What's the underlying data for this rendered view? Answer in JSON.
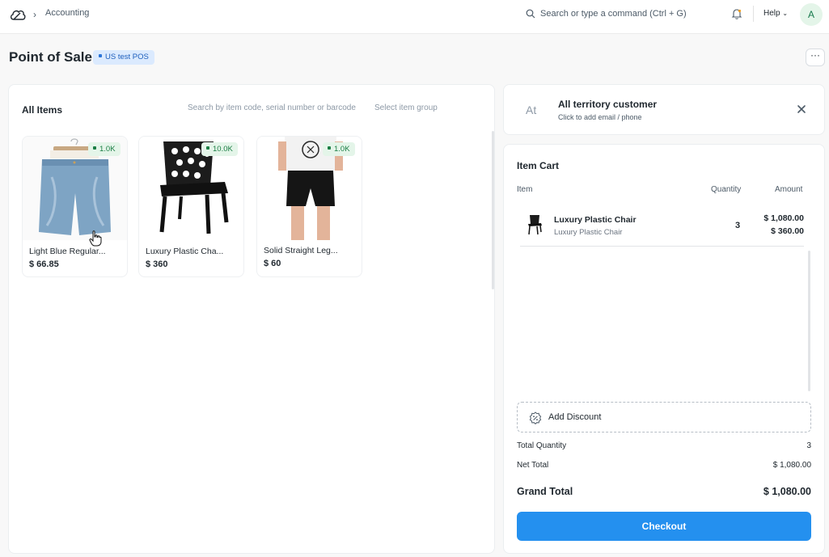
{
  "navbar": {
    "breadcrumb": "Accounting",
    "search_placeholder": "Search or type a command (Ctrl + G)",
    "help_label": "Help",
    "avatar_initial": "A"
  },
  "page": {
    "title": "Point of Sale",
    "pos_profile": "US test POS",
    "more_label": "···"
  },
  "items": {
    "title": "All Items",
    "search_placeholder": "Search by item code, serial number or barcode",
    "group_placeholder": "Select item group",
    "cards": [
      {
        "name": "Light Blue Regular...",
        "price": "$ 66.85",
        "stock": "1.0K",
        "image": "denim-shorts"
      },
      {
        "name": "Luxury Plastic Cha...",
        "price": "$ 360",
        "stock": "10.0K",
        "image": "black-chair"
      },
      {
        "name": "Solid Straight Leg...",
        "price": "$ 60",
        "stock": "1.0K",
        "image": "model-black-shorts"
      }
    ]
  },
  "customer": {
    "initials": "At",
    "name": "All territory customer",
    "subtitle": "Click to add email / phone"
  },
  "cart": {
    "title": "Item Cart",
    "col_item": "Item",
    "col_qty": "Quantity",
    "col_amount": "Amount",
    "rows": [
      {
        "name": "Luxury Plastic Chair",
        "description": "Luxury Plastic Chair",
        "qty": "3",
        "amount": "$ 1,080.00",
        "rate": "$ 360.00"
      }
    ],
    "discount_label": "Add Discount",
    "total_qty_label": "Total Quantity",
    "total_qty": "3",
    "net_total_label": "Net Total",
    "net_total": "$ 1,080.00",
    "grand_total_label": "Grand Total",
    "grand_total": "$ 1,080.00",
    "checkout_label": "Checkout"
  },
  "colors": {
    "primary": "#2490ef",
    "stock_badge_bg": "#e4f5e9",
    "stock_badge_text": "#1b7e44",
    "pos_badge_bg": "#dbeafe"
  }
}
